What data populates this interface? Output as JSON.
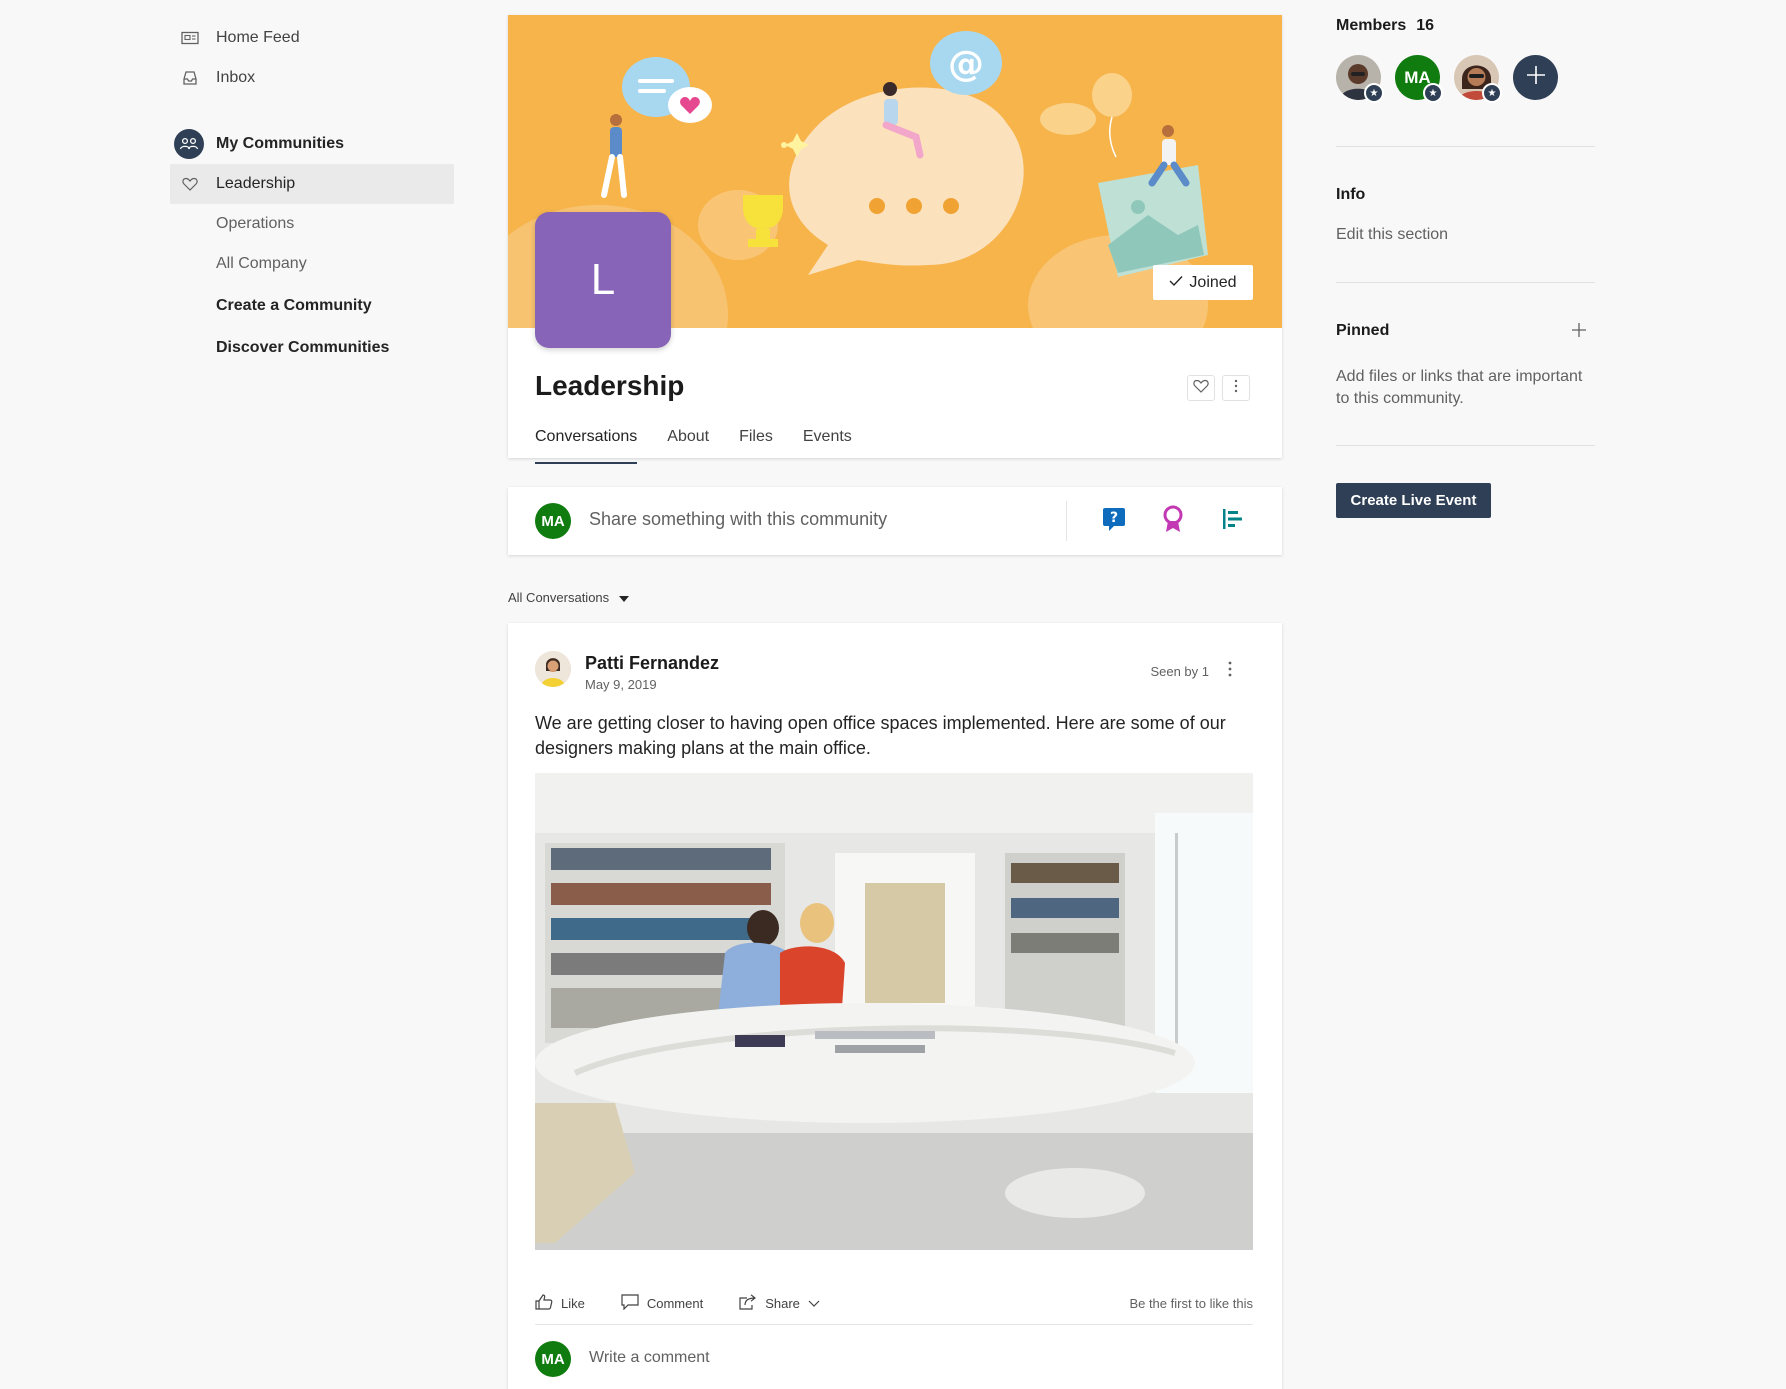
{
  "nav": {
    "home_feed": "Home Feed",
    "inbox": "Inbox",
    "my_communities": "My Communities",
    "communities": [
      "Leadership",
      "Operations",
      "All Company"
    ],
    "create_community": "Create a Community",
    "discover_communities": "Discover Communities"
  },
  "community": {
    "logo_letter": "L",
    "name": "Leadership",
    "joined_label": "Joined",
    "tabs": [
      "Conversations",
      "About",
      "Files",
      "Events"
    ],
    "active_tab": "Conversations"
  },
  "share": {
    "avatar_initials": "MA",
    "placeholder": "Share something with this community"
  },
  "feed": {
    "filter_label": "All Conversations",
    "post": {
      "author": "Patti Fernandez",
      "date": "May 9, 2019",
      "seen": "Seen by 1",
      "text": "We are getting closer to having open office spaces implemented. Here are some of our designers making plans at the main office.",
      "like_label": "Like",
      "comment_label": "Comment",
      "share_label": "Share",
      "first_like_label": "Be the first to like this",
      "comment_avatar_initials": "MA",
      "comment_placeholder": "Write a comment"
    }
  },
  "rail": {
    "members_label": "Members",
    "members_count": "16",
    "member_initials": "MA",
    "info_label": "Info",
    "info_edit": "Edit this section",
    "pinned_label": "Pinned",
    "pinned_text": "Add files or links that are important to this community.",
    "live_event_button": "Create Live Event"
  },
  "colors": {
    "accent": "#2f3f55",
    "banner": "#f6b44b",
    "logo_tile": "#8764b8",
    "avatar_green": "#107c10"
  }
}
